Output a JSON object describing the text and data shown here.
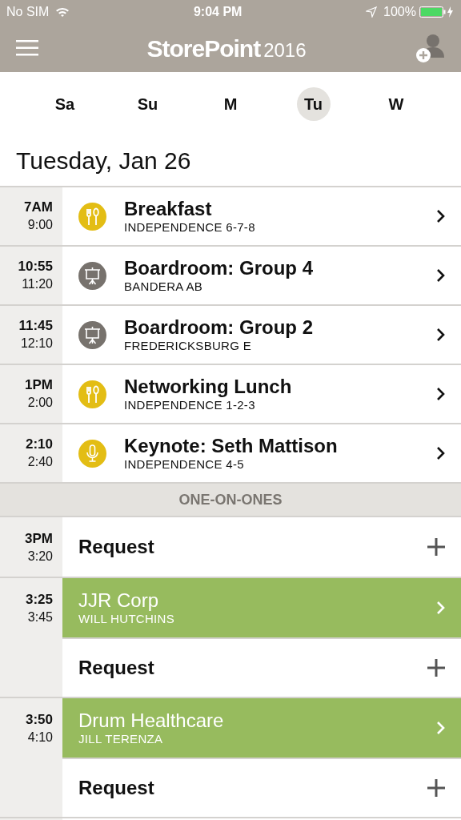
{
  "status_bar": {
    "carrier": "No SIM",
    "time": "9:04 PM",
    "battery": {
      "text": "100%",
      "level": 1.0
    }
  },
  "app_bar": {
    "logo": "StorePoint",
    "logo_year": "2016"
  },
  "days": [
    {
      "label": "Sa",
      "selected": false
    },
    {
      "label": "Su",
      "selected": false
    },
    {
      "label": "M",
      "selected": false
    },
    {
      "label": "Tu",
      "selected": true
    },
    {
      "label": "W",
      "selected": false
    }
  ],
  "date_heading": "Tuesday, Jan 26",
  "events": [
    {
      "start": "7AM",
      "end": "9:00",
      "title": "Breakfast",
      "location": "INDEPENDENCE 6-7-8",
      "kind": "meal",
      "color": "#e3bd14"
    },
    {
      "start": "10:55",
      "end": "11:20",
      "title": "Boardroom: Group 4",
      "location": "BANDERA AB",
      "kind": "presentation",
      "color": "#77726d"
    },
    {
      "start": "11:45",
      "end": "12:10",
      "title": "Boardroom: Group 2",
      "location": "FREDERICKSBURG E",
      "kind": "presentation",
      "color": "#77726d"
    },
    {
      "start": "1PM",
      "end": "2:00",
      "title": "Networking Lunch",
      "location": "INDEPENDENCE 1-2-3",
      "kind": "meal",
      "color": "#e3bd14"
    },
    {
      "start": "2:10",
      "end": "2:40",
      "title": "Keynote: Seth Mattison",
      "location": "INDEPENDENCE 4-5",
      "kind": "speaker",
      "color": "#e3bd14"
    }
  ],
  "section_header": "ONE-ON-ONES",
  "slots": [
    {
      "start": "3PM",
      "end": "3:20",
      "entries": [
        {
          "kind": "request",
          "title": "Request"
        }
      ]
    },
    {
      "start": "3:25",
      "end": "3:45",
      "entries": [
        {
          "kind": "meeting",
          "title": "JJR Corp",
          "subtitle": "WILL HUTCHINS"
        },
        {
          "kind": "request",
          "title": "Request"
        }
      ]
    },
    {
      "start": "3:50",
      "end": "4:10",
      "entries": [
        {
          "kind": "meeting",
          "title": "Drum Healthcare",
          "subtitle": "JILL TERENZA"
        },
        {
          "kind": "request",
          "title": "Request"
        }
      ]
    }
  ]
}
